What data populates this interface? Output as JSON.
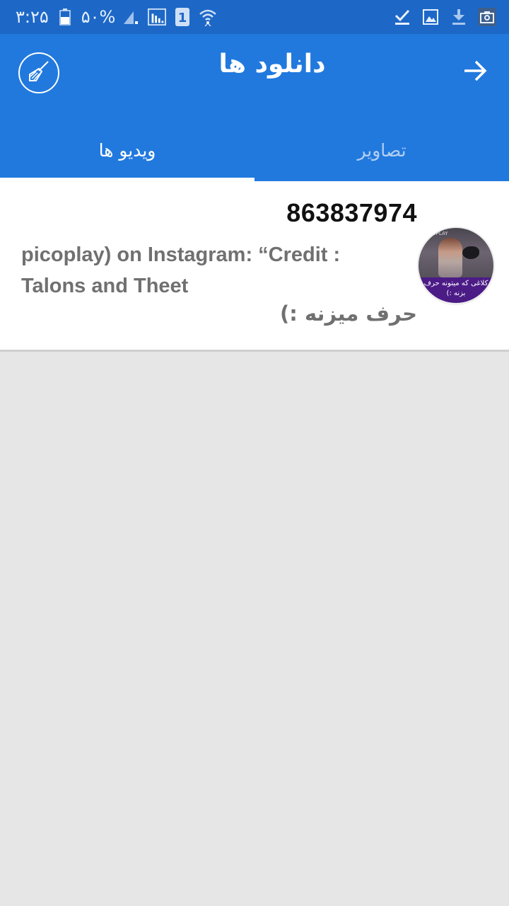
{
  "status_bar": {
    "time": "۳:۲۵",
    "battery": "۵۰%",
    "sim_badge": "1",
    "icons_left": [
      "battery-icon",
      "signal-icon",
      "signal-icon",
      "sim-icon",
      "wifi-icon"
    ],
    "icons_right": [
      "check-icon",
      "image-icon",
      "download-icon",
      "screenshot-icon"
    ]
  },
  "app_bar": {
    "title": "دانلود ها",
    "clear_icon": "broom-icon",
    "back_icon": "arrow-right-icon",
    "background": "#2179de"
  },
  "tabs": [
    {
      "label": "ویدیو ها",
      "active": true
    },
    {
      "label": "تصاویر",
      "active": false
    }
  ],
  "downloads": [
    {
      "id": "863837974",
      "description": "picoplay) on Instagram: “Credit : Talons and Theet",
      "description_rtl": "حرف میزنه :)",
      "thumbnail": {
        "brand": "PICOPLAY",
        "caption": "کلاغی که میتونه حرف بزنه :)"
      }
    }
  ]
}
